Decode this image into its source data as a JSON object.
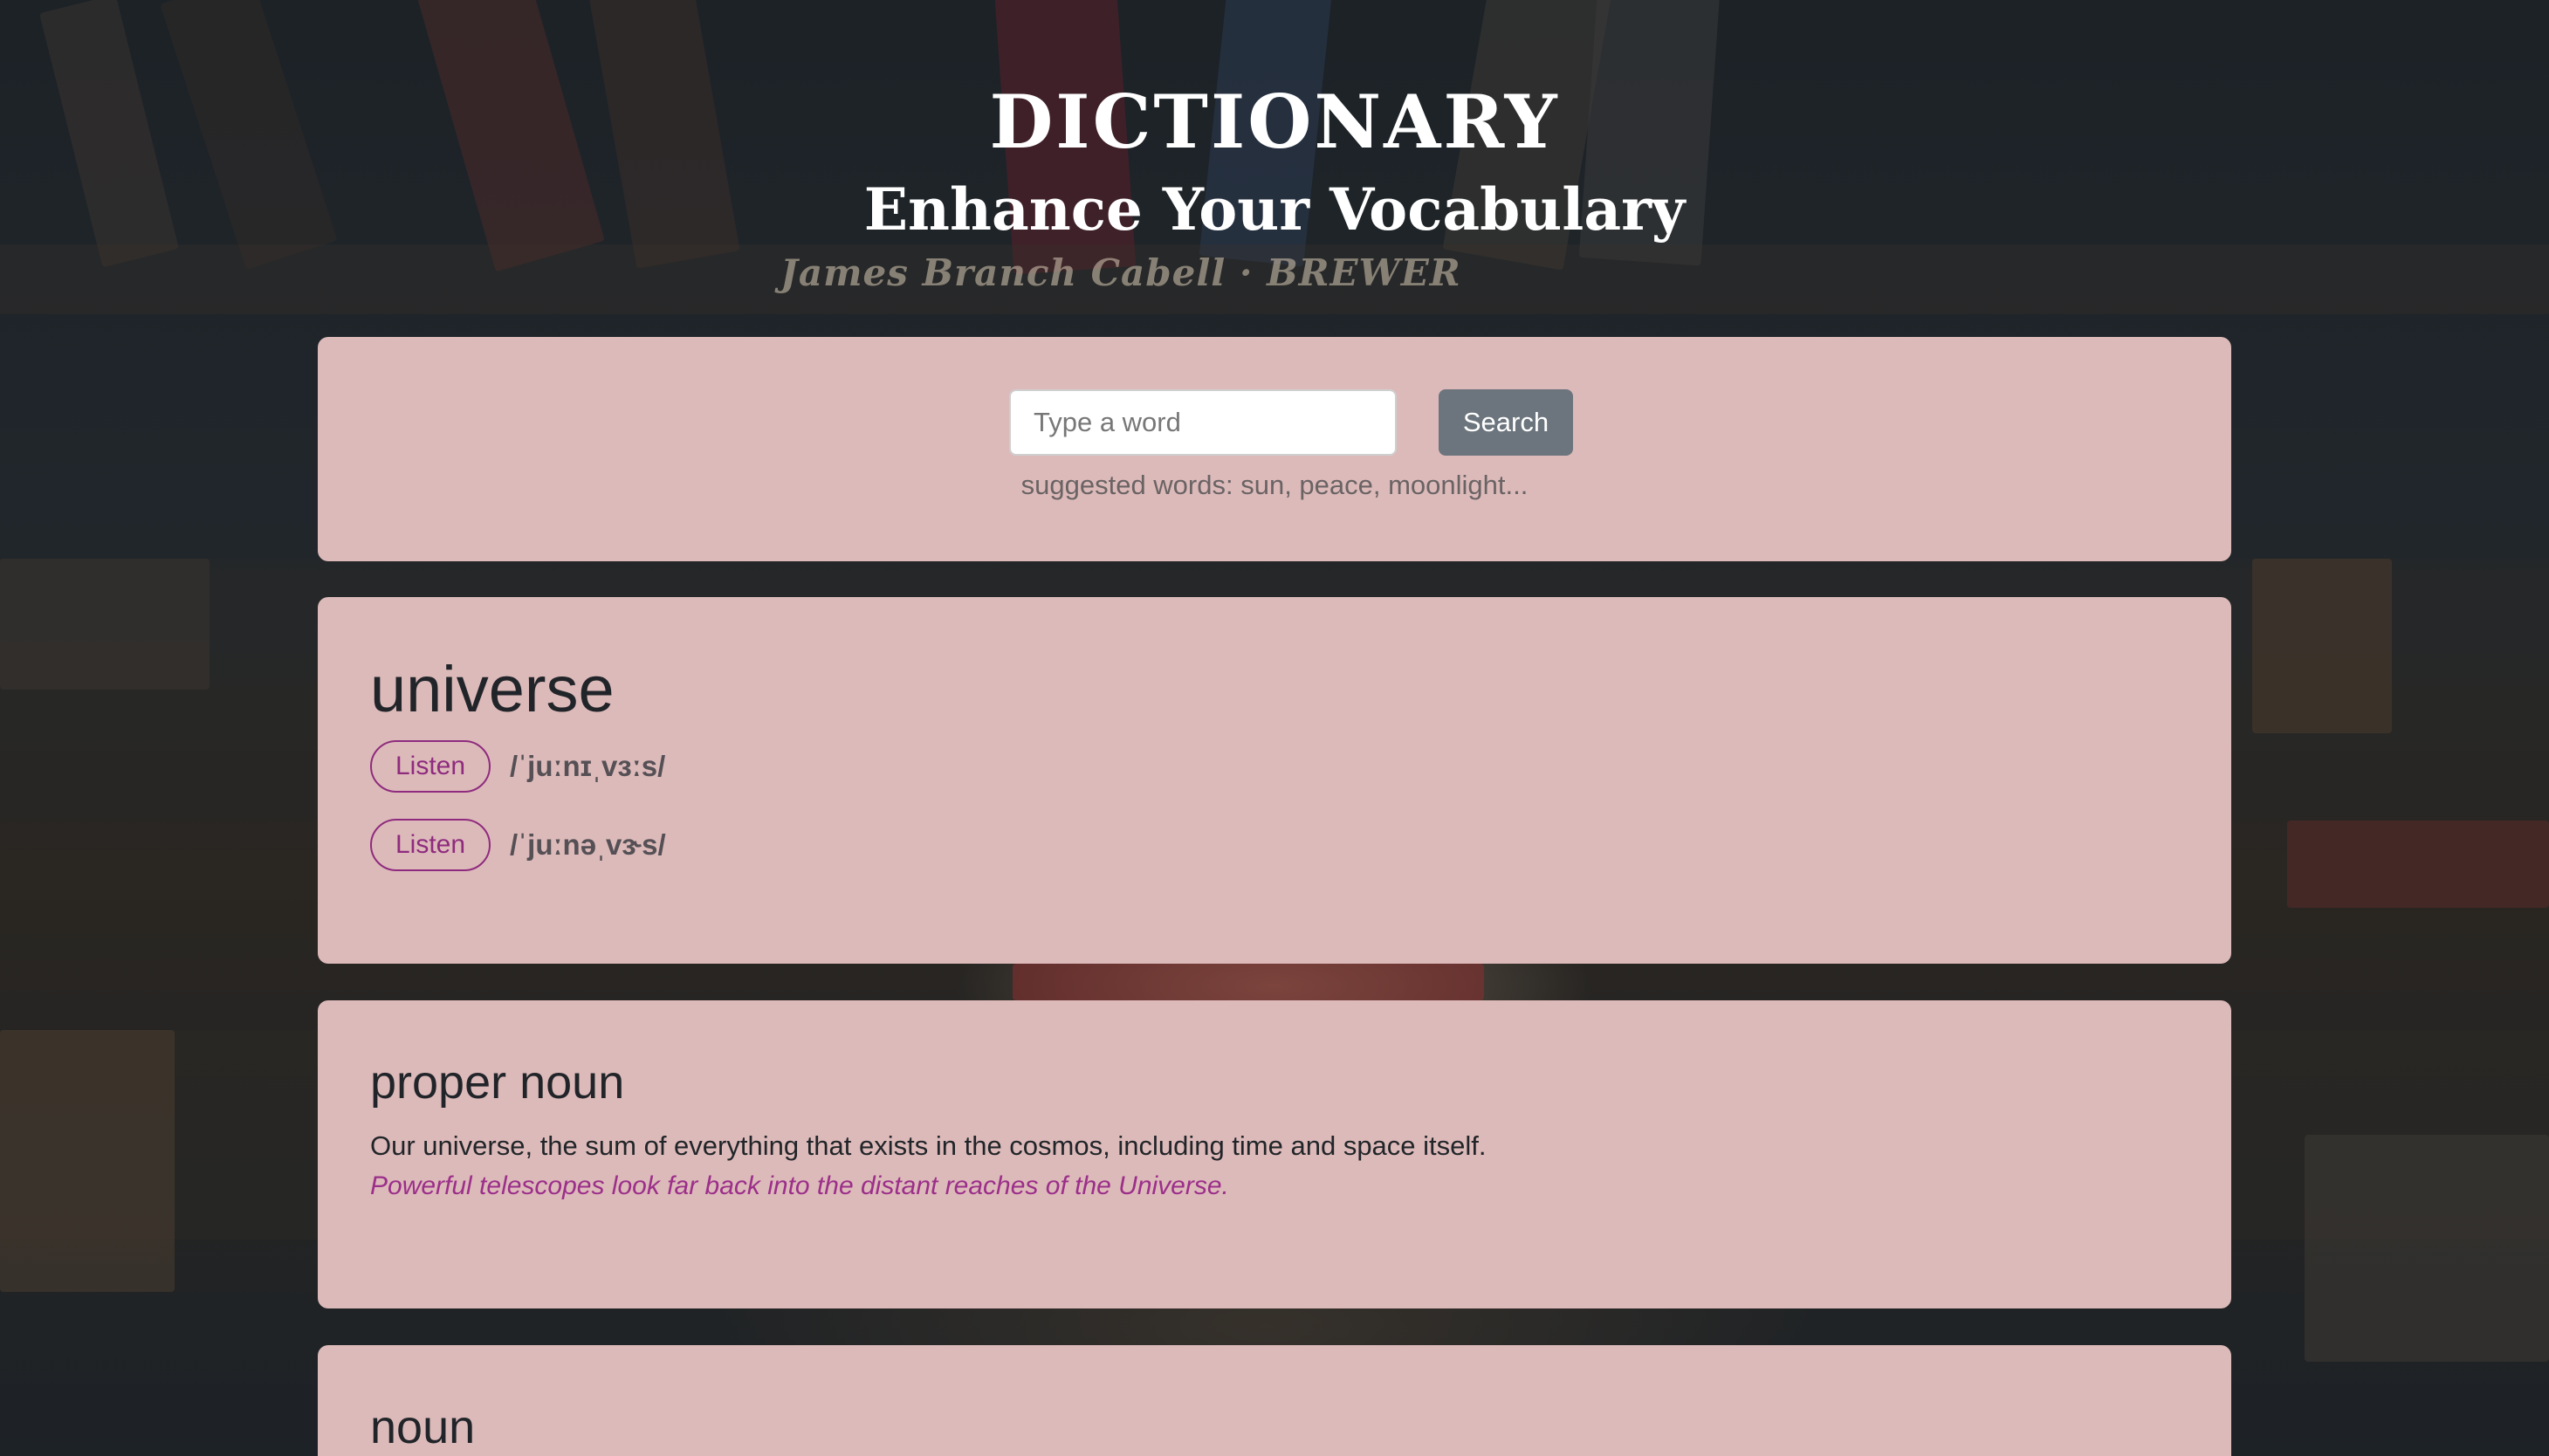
{
  "header": {
    "title": "DICTIONARY",
    "subtitle": "Enhance Your Vocabulary"
  },
  "background": {
    "book_text": "James Branch Cabell · BREWER"
  },
  "search": {
    "placeholder": "Type a word",
    "value": "",
    "button_label": "Search",
    "suggested": "suggested words: sun, peace, moonlight..."
  },
  "result": {
    "word": "universe",
    "phonetics": [
      {
        "listen_label": "Listen",
        "text": "/ˈjuːnɪˌvɜːs/"
      },
      {
        "listen_label": "Listen",
        "text": "/ˈjuːnəˌvɝs/"
      }
    ]
  },
  "meanings": [
    {
      "part_of_speech": "proper noun",
      "definition": "Our universe, the sum of everything that exists in the cosmos, including time and space itself.",
      "example": "Powerful telescopes look far back into the distant reaches of the Universe."
    },
    {
      "part_of_speech": "noun"
    }
  ],
  "colors": {
    "card_bg": "#ddbaba",
    "accent": "#8e2b7e",
    "example_text": "#9b2f8a",
    "button_bg": "#6c757d",
    "page_bg": "#1d2328"
  }
}
